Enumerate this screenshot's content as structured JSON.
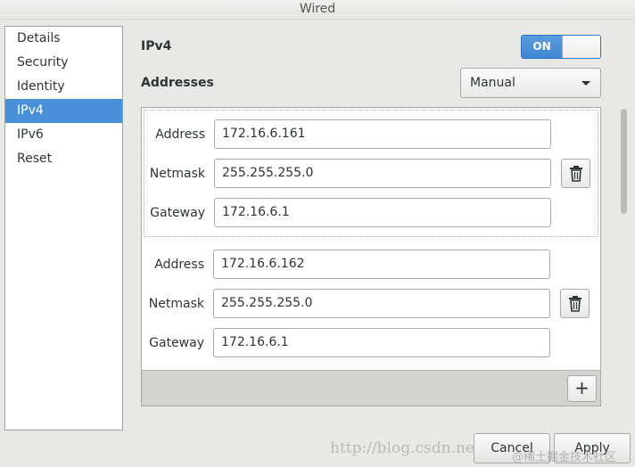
{
  "window": {
    "title": "Wired"
  },
  "sidebar": {
    "items": [
      {
        "label": "Details"
      },
      {
        "label": "Security"
      },
      {
        "label": "Identity"
      },
      {
        "label": "IPv4",
        "selected": true
      },
      {
        "label": "IPv6"
      },
      {
        "label": "Reset"
      }
    ]
  },
  "ipv4": {
    "label": "IPv4",
    "toggle": {
      "state_label": "ON",
      "on": true
    }
  },
  "addresses": {
    "label": "Addresses",
    "method": {
      "selected": "Manual"
    },
    "entries": [
      {
        "address_label": "Address",
        "address": "172.16.6.161",
        "netmask_label": "Netmask",
        "netmask": "255.255.255.0",
        "gateway_label": "Gateway",
        "gateway": "172.16.6.1"
      },
      {
        "address_label": "Address",
        "address": "172.16.6.162",
        "netmask_label": "Netmask",
        "netmask": "255.255.255.0",
        "gateway_label": "Gateway",
        "gateway": "172.16.6.1"
      }
    ],
    "add_label": "+"
  },
  "buttons": {
    "cancel": "Cancel",
    "apply": "Apply"
  },
  "watermark": {
    "text": "http://blog.csdn.ne",
    "text2": "@稀土掘金技术社区"
  },
  "colors": {
    "accent": "#4a90d9",
    "selected_bg": "#4a90d9"
  },
  "icons": {
    "delete": "trash-icon",
    "dropdown": "chevron-down-icon",
    "add": "plus-icon"
  }
}
